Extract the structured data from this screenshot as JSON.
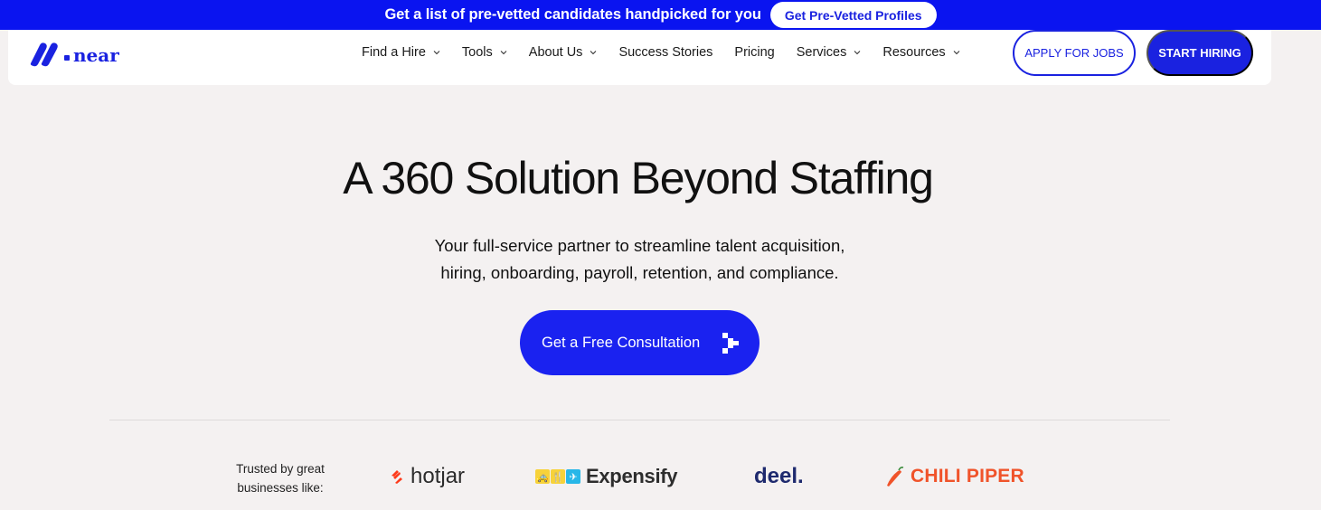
{
  "promo": {
    "text": "Get a list of pre-vetted candidates handpicked for you",
    "button": "Get Pre-Vetted Profiles"
  },
  "nav": {
    "logo_text": "near",
    "items": [
      {
        "label": "Find a Hire",
        "dropdown": true
      },
      {
        "label": "Tools",
        "dropdown": true
      },
      {
        "label": "About Us",
        "dropdown": true
      },
      {
        "label": "Success Stories",
        "dropdown": false
      },
      {
        "label": "Pricing",
        "dropdown": false
      },
      {
        "label": "Services",
        "dropdown": true
      },
      {
        "label": "Resources",
        "dropdown": true
      }
    ],
    "apply_button": "APPLY FOR JOBS",
    "start_button": "START HIRING"
  },
  "hero": {
    "title": "A 360 Solution Beyond Staffing",
    "subtitle_line1": "Your full-service partner to streamline talent acquisition,",
    "subtitle_line2": "hiring, onboarding, payroll, retention, and compliance.",
    "cta": "Get a Free Consultation"
  },
  "trusted": {
    "label_line1": "Trusted by great",
    "label_line2": "businesses like:",
    "logos": [
      "hotjar",
      "Expensify",
      "deel.",
      "CHILI PIPER"
    ]
  },
  "colors": {
    "brand": "#1a22e0",
    "banner": "#0a14f0",
    "background": "#f4f1f1",
    "hotjar": "#fd3a1a",
    "chili": "#f0532a"
  }
}
